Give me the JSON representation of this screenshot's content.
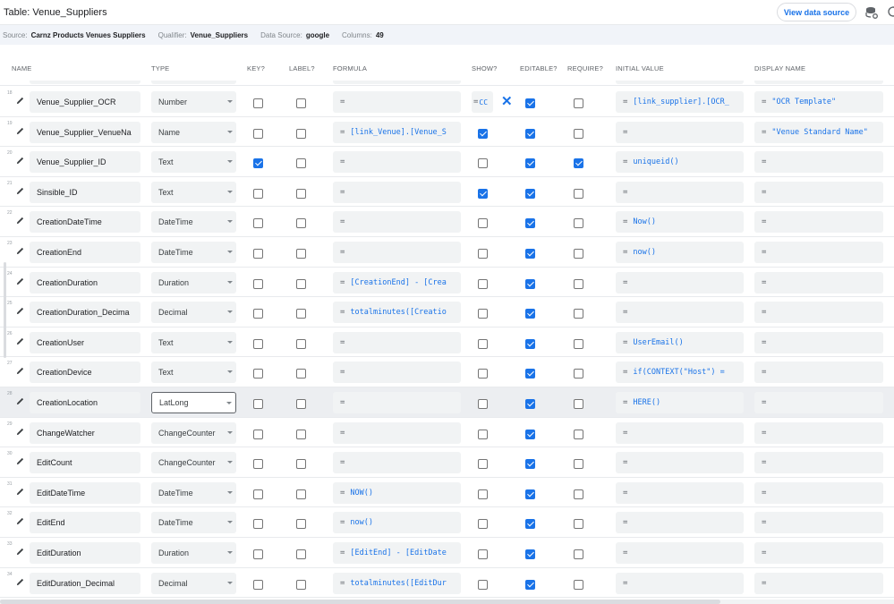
{
  "header": {
    "title": "Table: Venue_Suppliers",
    "view_button": "View data source"
  },
  "info": {
    "source_label": "Source:",
    "source_value": "Carnz Products Venues Suppliers",
    "qualifier_label": "Qualifier:",
    "qualifier_value": "Venue_Suppliers",
    "datasource_label": "Data Source:",
    "datasource_value": "google",
    "columns_label": "Columns:",
    "columns_value": "49"
  },
  "columns": {
    "name": "NAME",
    "type": "TYPE",
    "key": "KEY?",
    "label": "LABEL?",
    "formula": "FORMULA",
    "show": "SHOW?",
    "editable": "EDITABLE?",
    "require": "REQUIRE?",
    "initial_value": "INITIAL VALUE",
    "display_name": "DISPLAY NAME"
  },
  "eq_symbol": "=",
  "rows": [
    {
      "num": "18",
      "name": "Venue_Supplier_OCR",
      "type": "Number",
      "key": false,
      "label": false,
      "formula": "",
      "show": "formula",
      "show_formula": "CC",
      "editable": true,
      "require": false,
      "initial": "[link_supplier].[OCR_",
      "display": "\"OCR Template\""
    },
    {
      "num": "19",
      "name": "Venue_Supplier_VenueNa",
      "type": "Name",
      "key": false,
      "label": false,
      "formula": "[link_Venue].[Venue_S",
      "show": true,
      "editable": true,
      "require": false,
      "initial": "",
      "display": "\"Venue Standard Name\""
    },
    {
      "num": "20",
      "name": "Venue_Supplier_ID",
      "type": "Text",
      "key": true,
      "label": false,
      "formula": "",
      "show": false,
      "editable": true,
      "require": true,
      "initial": "uniqueid()",
      "display": ""
    },
    {
      "num": "21",
      "name": "Sinsible_ID",
      "type": "Text",
      "key": false,
      "label": false,
      "formula": "",
      "show": true,
      "editable": true,
      "require": false,
      "initial": "",
      "display": ""
    },
    {
      "num": "22",
      "name": "CreationDateTime",
      "type": "DateTime",
      "key": false,
      "label": false,
      "formula": "",
      "show": false,
      "editable": true,
      "require": false,
      "initial": "Now()",
      "display": ""
    },
    {
      "num": "23",
      "name": "CreationEnd",
      "type": "DateTime",
      "key": false,
      "label": false,
      "formula": "",
      "show": false,
      "editable": true,
      "require": false,
      "initial": "now()",
      "display": ""
    },
    {
      "num": "24",
      "name": "CreationDuration",
      "type": "Duration",
      "key": false,
      "label": false,
      "formula": "[CreationEnd] - [Crea",
      "show": false,
      "editable": true,
      "require": false,
      "initial": "",
      "display": ""
    },
    {
      "num": "25",
      "name": "CreationDuration_Decima",
      "type": "Decimal",
      "key": false,
      "label": false,
      "formula": "totalminutes([Creatio",
      "show": false,
      "editable": true,
      "require": false,
      "initial": "",
      "display": ""
    },
    {
      "num": "26",
      "name": "CreationUser",
      "type": "Text",
      "key": false,
      "label": false,
      "formula": "",
      "show": false,
      "editable": true,
      "require": false,
      "initial": "UserEmail()",
      "display": ""
    },
    {
      "num": "27",
      "name": "CreationDevice",
      "type": "Text",
      "key": false,
      "label": false,
      "formula": "",
      "show": false,
      "editable": true,
      "require": false,
      "initial": "if(CONTEXT(\"Host\") =",
      "display": ""
    },
    {
      "num": "28",
      "name": "CreationLocation",
      "type": "LatLong",
      "key": false,
      "label": false,
      "formula": "",
      "show": false,
      "editable": true,
      "require": false,
      "initial": "HERE()",
      "display": "",
      "highlight": true
    },
    {
      "num": "29",
      "name": "ChangeWatcher",
      "type": "ChangeCounter",
      "key": false,
      "label": false,
      "formula": "",
      "show": false,
      "editable": true,
      "require": false,
      "initial": "",
      "display": ""
    },
    {
      "num": "30",
      "name": "EditCount",
      "type": "ChangeCounter",
      "key": false,
      "label": false,
      "formula": "",
      "show": false,
      "editable": true,
      "require": false,
      "initial": "",
      "display": ""
    },
    {
      "num": "31",
      "name": "EditDateTime",
      "type": "DateTime",
      "key": false,
      "label": false,
      "formula": "NOW()",
      "show": false,
      "editable": true,
      "require": false,
      "initial": "",
      "display": ""
    },
    {
      "num": "32",
      "name": "EditEnd",
      "type": "DateTime",
      "key": false,
      "label": false,
      "formula": "now()",
      "show": false,
      "editable": true,
      "require": false,
      "initial": "",
      "display": ""
    },
    {
      "num": "33",
      "name": "EditDuration",
      "type": "Duration",
      "key": false,
      "label": false,
      "formula": "[EditEnd] - [EditDate",
      "show": false,
      "editable": true,
      "require": false,
      "initial": "",
      "display": ""
    },
    {
      "num": "34",
      "name": "EditDuration_Decimal",
      "type": "Decimal",
      "key": false,
      "label": false,
      "formula": "totalminutes([EditDur",
      "show": false,
      "editable": true,
      "require": false,
      "initial": "",
      "display": ""
    }
  ],
  "colors": {
    "accent": "#1a73e8",
    "info_bg": "#f1f4f9",
    "field_bg": "#f1f3f4"
  }
}
